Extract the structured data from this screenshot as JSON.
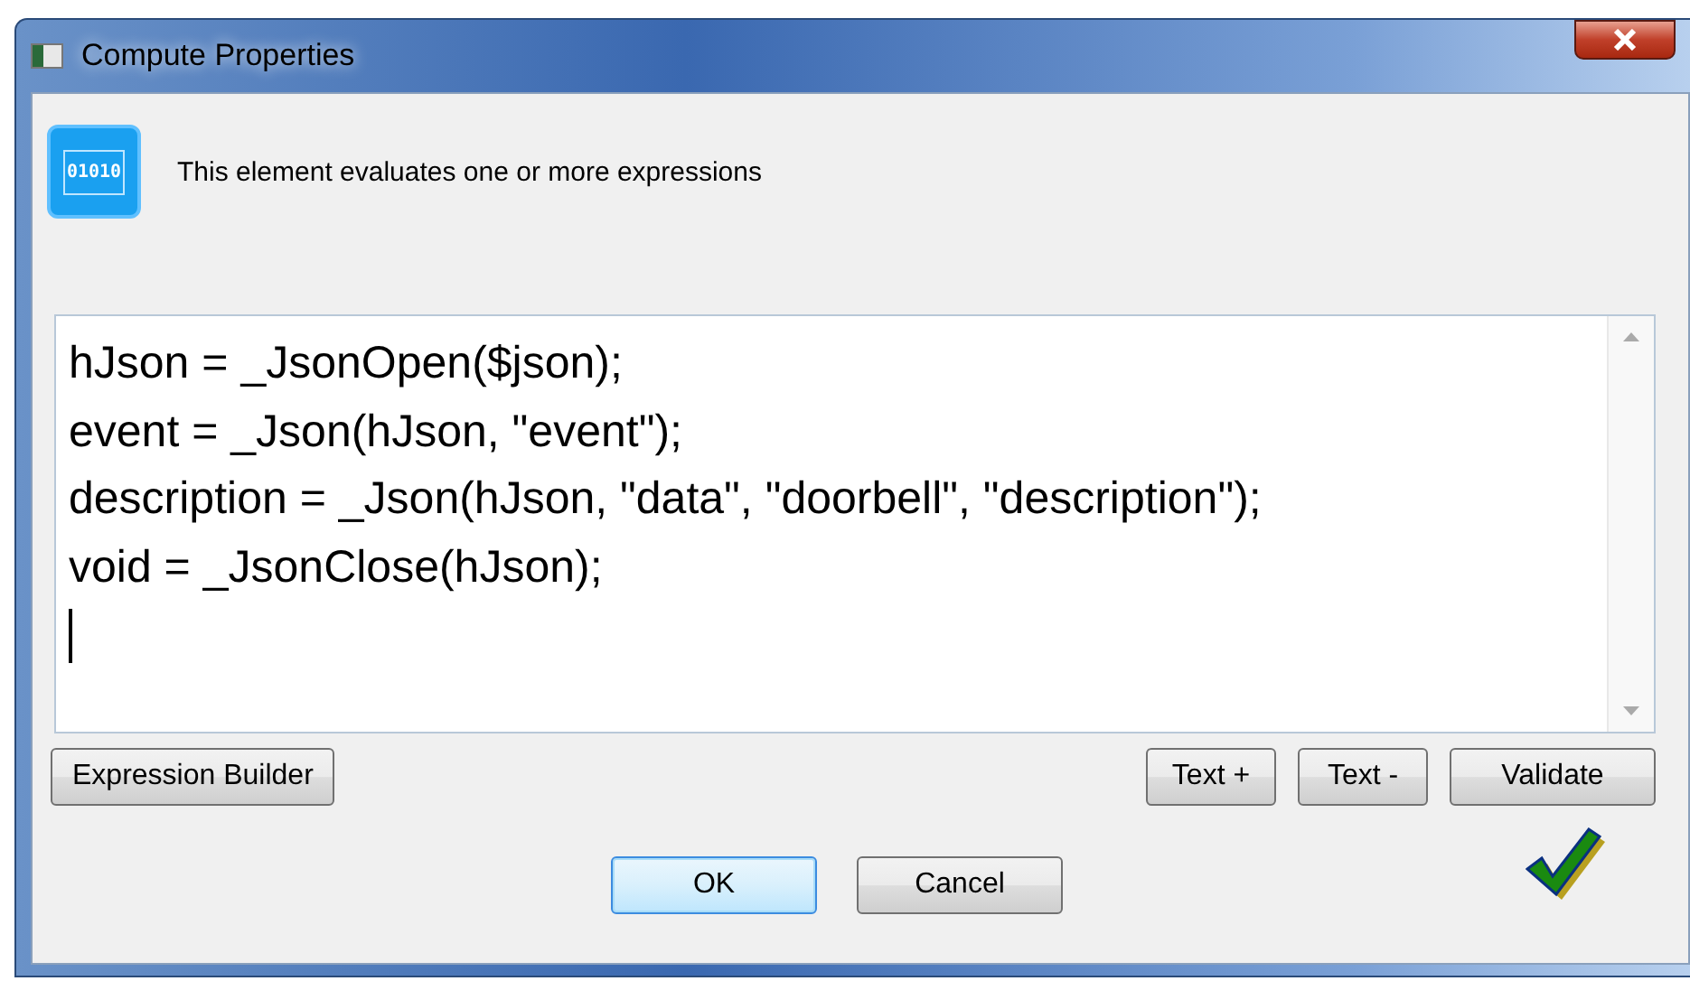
{
  "window": {
    "title": "Compute Properties"
  },
  "header": {
    "description": "This element evaluates one or more expressions",
    "icon_text": "01010"
  },
  "editor": {
    "lines": [
      "hJson = _JsonOpen($json);",
      "event = _Json(hJson, \"event\");",
      "description = _Json(hJson, \"data\", \"doorbell\", \"description\");",
      "void = _JsonClose(hJson);"
    ],
    "caret_on_new_line": true
  },
  "tool_buttons": [
    {
      "label": "Expression Builder",
      "kind": "left"
    },
    {
      "label": "Text +",
      "kind": "right"
    },
    {
      "label": "Text -",
      "kind": "right"
    },
    {
      "label": "Validate",
      "kind": "right"
    }
  ],
  "validated": true,
  "dialog_buttons": [
    {
      "label": "OK",
      "default": true
    },
    {
      "label": "Cancel",
      "default": false
    }
  ]
}
